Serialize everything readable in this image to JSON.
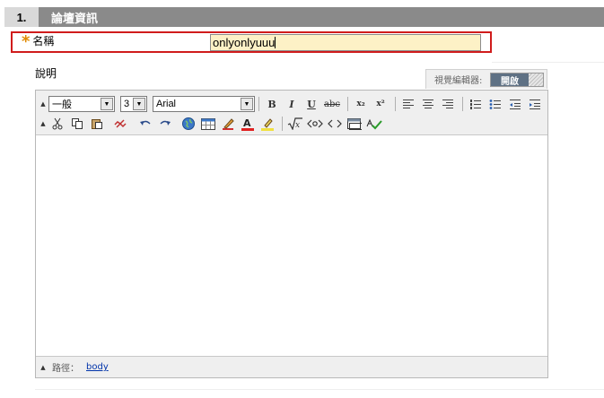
{
  "section": {
    "number": "1.",
    "title": "論壇資訊"
  },
  "name_field": {
    "required_mark": "*",
    "label": "名稱",
    "value": "onlyonlyuuu"
  },
  "description": {
    "label": "說明"
  },
  "visual_editor": {
    "label": "視覺編輯器:",
    "toggle_on": "開啟"
  },
  "toolbar": {
    "format_select": "一般",
    "size_select": "3",
    "font_select": "Arial",
    "bold": "B",
    "italic": "I",
    "underline": "U",
    "strike": "abc",
    "subscript": "x₂",
    "superscript": "x²"
  },
  "statusbar": {
    "path_label": "路徑：",
    "path_value": "body"
  },
  "colors": {
    "header_bg": "#8a8a8a",
    "required_border": "#d01c1c",
    "input_bg": "#fdf1c6",
    "toggle_on_bg": "#5f7184"
  }
}
